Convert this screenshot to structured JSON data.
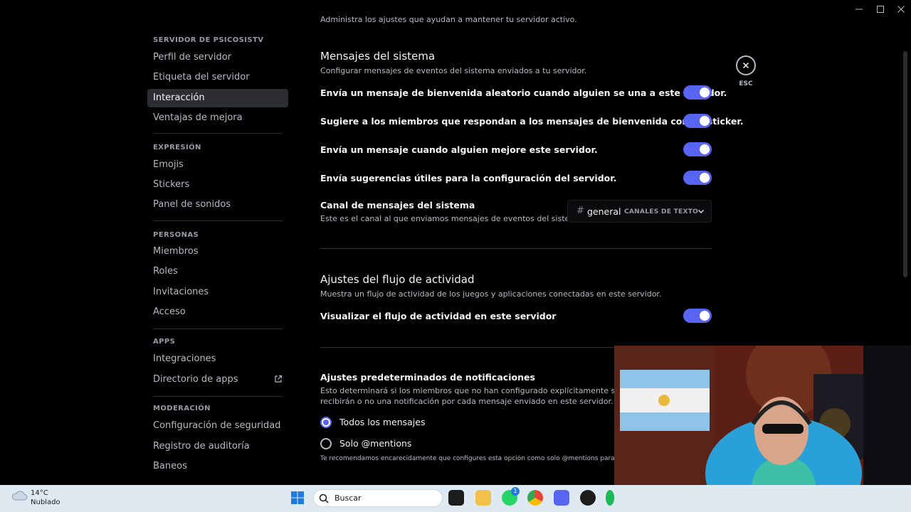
{
  "window": {
    "minimize": "—",
    "maximize": "□",
    "close": "✕"
  },
  "sidebar": {
    "sections": [
      {
        "header": "SERVIDOR DE PSICOSISTV",
        "items": [
          "Perfil de servidor",
          "Etiqueta del servidor",
          "Interacción",
          "Ventajas de mejora"
        ]
      },
      {
        "header": "EXPRESIÓN",
        "items": [
          "Emojis",
          "Stickers",
          "Panel de sonidos"
        ]
      },
      {
        "header": "PERSONAS",
        "items": [
          "Miembros",
          "Roles",
          "Invitaciones",
          "Acceso"
        ]
      },
      {
        "header": "APPS",
        "items": [
          "Integraciones",
          "Directorio de apps"
        ]
      },
      {
        "header": "MODERACIÓN",
        "items": [
          "Configuración de seguridad",
          "Registro de auditoría",
          "Baneos"
        ]
      }
    ],
    "active_item": "Interacción"
  },
  "main": {
    "top_text": "Administra los ajustes que ayudan a mantener tu servidor activo.",
    "system_messages": {
      "title": "Mensajes del sistema",
      "description": "Configurar mensajes de eventos del sistema enviados a tu servidor.",
      "options": [
        {
          "label": "Envía un mensaje de bienvenida aleatorio cuando alguien se una a este servidor.",
          "enabled": true
        },
        {
          "label": "Sugiere a los miembros que respondan a los mensajes de bienvenida con un sticker.",
          "enabled": true
        },
        {
          "label": "Envía un mensaje cuando alguien mejore este servidor.",
          "enabled": true
        },
        {
          "label": "Envía sugerencias útiles para la configuración del servidor.",
          "enabled": true
        }
      ],
      "channel": {
        "title": "Canal de mensajes del sistema",
        "description": "Este es el canal al que enviamos mensajes de eventos del sistema.",
        "hash": "#",
        "selected": "general",
        "category": "CANALES DE TEXTO"
      }
    },
    "activity_feed": {
      "title": "Ajustes del flujo de actividad",
      "description": "Muestra un flujo de actividad de los juegos y aplicaciones conectadas en este servidor.",
      "option": {
        "label": "Visualizar el flujo de actividad en este servidor",
        "enabled": true
      }
    },
    "notifications": {
      "title": "Ajustes predeterminados de notificaciones",
      "description_1": "Esto determinará si los miembros que no han configurado explícitamente sus ajustes",
      "description_2": "recibirán o no una notificación por cada mensaje enviado en este servidor.",
      "radios": [
        {
          "label": "Todos los mensajes",
          "selected": true
        },
        {
          "label": "Solo @mentions",
          "selected": false
        }
      ],
      "hint": "Te recomendamos encarecidamente que configures esta opción como solo @mentions para un se"
    },
    "esc_label": "ESC"
  },
  "taskbar": {
    "weather_temp": "14°C",
    "weather_status": "Nublado",
    "search_placeholder": "Buscar",
    "badge_count": "1"
  },
  "colors": {
    "accent": "#5865f2",
    "background": "#000000",
    "text_primary": "#f2f3f5",
    "text_muted": "#b5bac1"
  }
}
